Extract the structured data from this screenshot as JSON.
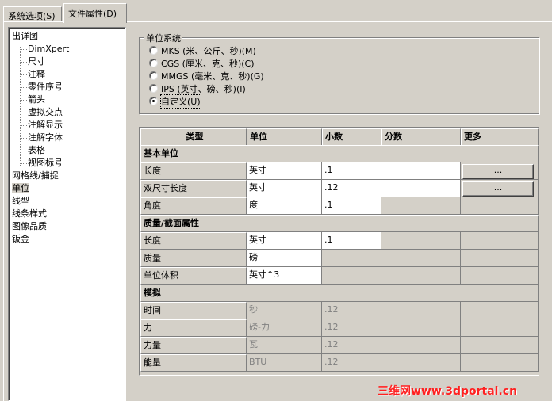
{
  "tabs": [
    {
      "label": "系统选项(S)"
    },
    {
      "label": "文件属性(D)"
    }
  ],
  "tree": {
    "items": [
      {
        "label": "出详图"
      },
      {
        "label": "DimXpert"
      },
      {
        "label": "尺寸"
      },
      {
        "label": "注释"
      },
      {
        "label": "零件序号"
      },
      {
        "label": "箭头"
      },
      {
        "label": "虚拟交点"
      },
      {
        "label": "注解显示"
      },
      {
        "label": "注解字体"
      },
      {
        "label": "表格"
      },
      {
        "label": "视图标号"
      },
      {
        "label": "网格线/捕捉"
      },
      {
        "label": "单位"
      },
      {
        "label": "线型"
      },
      {
        "label": "线条样式"
      },
      {
        "label": "图像品质"
      },
      {
        "label": "钣金"
      }
    ]
  },
  "units": {
    "title": "单位系统",
    "options": [
      {
        "label": "MKS (米、公斤、秒)(M)"
      },
      {
        "label": "CGS (厘米、克、秒)(C)"
      },
      {
        "label": "MMGS (毫米、克、秒)(G)"
      },
      {
        "label": "IPS (英寸、磅、秒)(I)"
      },
      {
        "label": "自定义(U)"
      }
    ],
    "selected": "自定义(U)"
  },
  "grid": {
    "headers": [
      "类型",
      "单位",
      "小数",
      "分数",
      "更多"
    ],
    "more_label": "...",
    "sections": [
      {
        "title": "基本单位"
      },
      {
        "title": "质量/截面属性"
      },
      {
        "title": "模拟"
      }
    ],
    "rows": [
      {
        "type": "长度",
        "unit": "英寸",
        "decimal": ".1"
      },
      {
        "type": "双尺寸长度",
        "unit": "英寸",
        "decimal": ".12"
      },
      {
        "type": "角度",
        "unit": "度",
        "decimal": ".1"
      },
      {
        "type": "长度",
        "unit": "英寸",
        "decimal": ".1"
      },
      {
        "type": "质量",
        "unit": "磅"
      },
      {
        "type": "单位体积",
        "unit": "英寸^3"
      },
      {
        "type": "时间",
        "unit": "秒",
        "decimal": ".12"
      },
      {
        "type": "力",
        "unit": "磅-力",
        "decimal": ".12"
      },
      {
        "type": "力量",
        "unit": "瓦",
        "decimal": ".12"
      },
      {
        "type": "能量",
        "unit": "BTU",
        "decimal": ".12"
      }
    ]
  },
  "watermark": "三维网www.3dportal.cn"
}
